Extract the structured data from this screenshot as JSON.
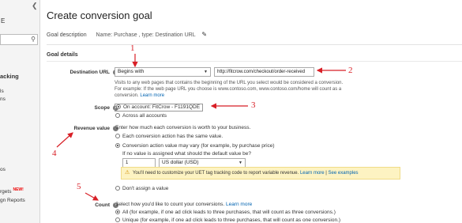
{
  "sidebar": {
    "letter": "E",
    "tracking_label": "acking",
    "items": [
      {
        "label": "ls"
      },
      {
        "label": "ns"
      },
      {
        "label": "os"
      },
      {
        "label": "rgets",
        "badge": "NEW!"
      },
      {
        "label": "gn Reports"
      }
    ]
  },
  "page": {
    "title": "Create conversion goal",
    "goal_description_label": "Goal description",
    "goal_description_value": "Name: Purchase , type: Destination URL",
    "section_title": "Goal details"
  },
  "destination": {
    "label": "Destination URL",
    "match_type": "Begins with",
    "url_value": "http://fitcrow.com/checkout/order-received",
    "hint_line1": "Visits to any web pages that contains the beginning of the URL you select would be considered a conversion.",
    "hint_line2": "For example: If the web page URL you choose is www.contoso.com, www.contoso.com/home will count as a",
    "hint_line3": "conversion.",
    "learn_more": "Learn more"
  },
  "scope": {
    "label": "Scope",
    "option1": "On account: FitCrow - F1191QDE",
    "option2": "Across all accounts"
  },
  "revenue": {
    "label": "Revenue value",
    "intro": "Enter how much each conversion is worth to your business.",
    "option1": "Each conversion action has the same value.",
    "option2": "Conversion action value may vary (for example, by purchase price)",
    "default_prompt": "If no value is assigned what should the default value be?",
    "default_value": "1",
    "currency": "US dollar (USD)",
    "warning_text": "You'll need to customize your UET tag tracking code to report variable revenue.",
    "warning_learn_more": "Learn more",
    "warning_sep": " | ",
    "warning_examples": "See examples",
    "option3": "Don't assign a value"
  },
  "count": {
    "label": "Count",
    "intro": "Select how you'd like to count your conversions.",
    "learn_more": "Learn more",
    "option1": "All (for example, if one ad click leads to three purchases, that will count as three conversions.)",
    "option2": "Unique (for example, if one ad click leads to three purchases, that will count as one conversion.)"
  },
  "annotations": {
    "n1": "1",
    "n2": "2",
    "n3": "3",
    "n4": "4",
    "n5": "5",
    "color": "#d81f26"
  }
}
